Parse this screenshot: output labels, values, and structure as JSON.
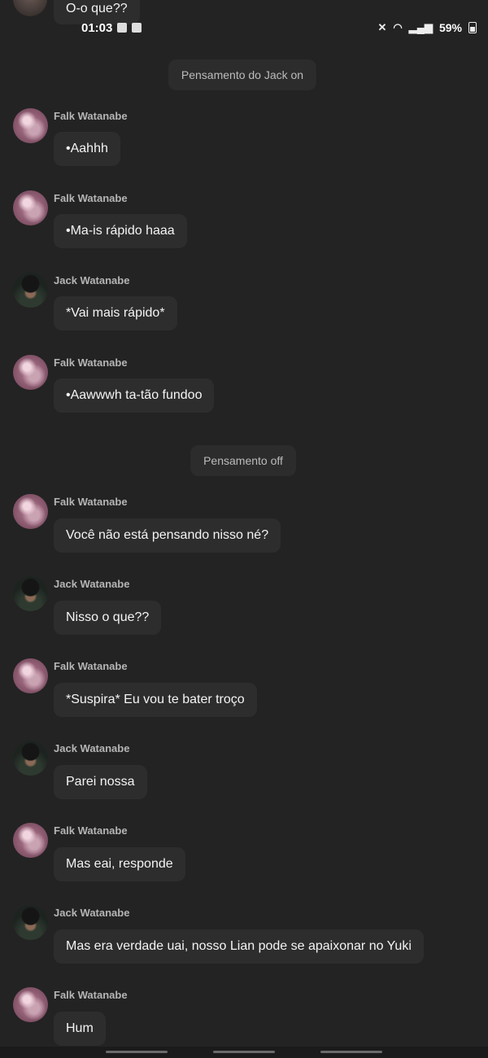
{
  "status_bar": {
    "time": "01:03",
    "battery": "59%"
  },
  "top_message": {
    "text": "O-o que??"
  },
  "system_messages": [
    {
      "text": "Pensamento do Jack on"
    },
    {
      "text": "Pensamento off"
    }
  ],
  "messages": [
    {
      "sender": "Falk Watanabe",
      "avatar": "falk",
      "text": "•Aahhh"
    },
    {
      "sender": "Falk Watanabe",
      "avatar": "falk",
      "text": "•Ma-is rápido haaa"
    },
    {
      "sender": "Jack Watanabe",
      "avatar": "jack",
      "text": "*Vai mais rápido*"
    },
    {
      "sender": "Falk Watanabe",
      "avatar": "falk",
      "text": "•Aawwwh ta-tão fundoo"
    },
    {
      "sender": "Falk Watanabe",
      "avatar": "falk",
      "text": "Você não está pensando nisso né?"
    },
    {
      "sender": "Jack Watanabe",
      "avatar": "jack",
      "text": "Nisso o que??"
    },
    {
      "sender": "Falk Watanabe",
      "avatar": "falk",
      "text": "*Suspira* Eu vou te bater troço"
    },
    {
      "sender": "Jack Watanabe",
      "avatar": "jack",
      "text": "Parei nossa"
    },
    {
      "sender": "Falk Watanabe",
      "avatar": "falk",
      "text": "Mas eai, responde"
    },
    {
      "sender": "Jack Watanabe",
      "avatar": "jack",
      "text": "Mas era verdade uai, nosso Lian pode se apaixonar no Yuki"
    },
    {
      "sender": "Falk Watanabe",
      "avatar": "falk",
      "text": "Hum"
    }
  ]
}
